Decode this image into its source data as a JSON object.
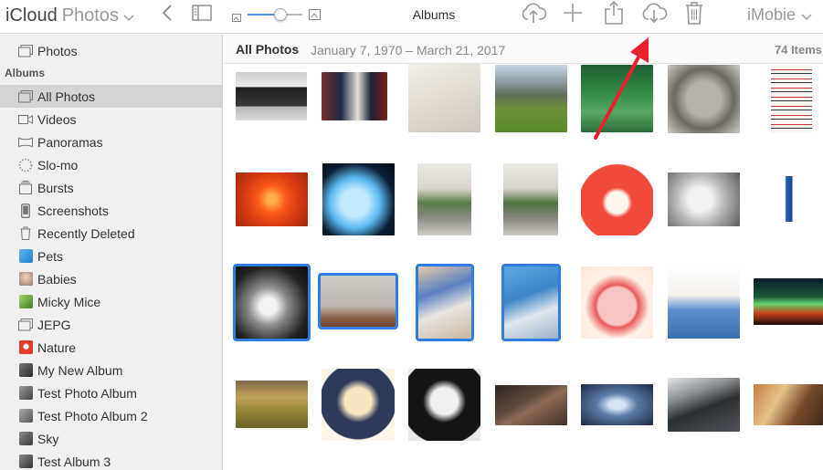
{
  "toolbar": {
    "app_name": "iCloud",
    "section_name": "Photos",
    "center_title": "Albums",
    "account": "iMobie",
    "icons": [
      "chevron-down",
      "back-chevron",
      "sidebar-toggle",
      "zoom-slider",
      "cloud-upload",
      "plus",
      "share",
      "cloud-download",
      "trash"
    ],
    "zoom_level": 0.6
  },
  "sidebar": {
    "top_item": {
      "label": "Photos",
      "icon": "photos-icon"
    },
    "albums_header": "Albums",
    "items": [
      {
        "label": "All Photos",
        "icon": "album-icon",
        "selected": true
      },
      {
        "label": "Videos",
        "icon": "video-icon"
      },
      {
        "label": "Panoramas",
        "icon": "panorama-icon"
      },
      {
        "label": "Slo-mo",
        "icon": "slomo-icon"
      },
      {
        "label": "Bursts",
        "icon": "bursts-icon"
      },
      {
        "label": "Screenshots",
        "icon": "screenshot-icon"
      },
      {
        "label": "Recently Deleted",
        "icon": "trash-icon"
      },
      {
        "label": "Pets",
        "icon": "pets-thumb"
      },
      {
        "label": "Babies",
        "icon": "babies-thumb"
      },
      {
        "label": "Micky Mice",
        "icon": "micky-thumb"
      },
      {
        "label": "JEPG",
        "icon": "album-icon"
      },
      {
        "label": "Nature",
        "icon": "nature-thumb"
      },
      {
        "label": "My New Album",
        "icon": "album-thumb"
      },
      {
        "label": "Test Photo Album",
        "icon": "album-thumb"
      },
      {
        "label": "Test Photo Album 2",
        "icon": "album-thumb"
      },
      {
        "label": "Sky",
        "icon": "album-thumb"
      },
      {
        "label": "Test Album 3",
        "icon": "album-thumb"
      }
    ]
  },
  "content": {
    "album_title": "All Photos",
    "date_range": "January 7, 1970 – March 21, 2017",
    "item_count": "74 Items",
    "photos": [
      {
        "name": "imac-desk",
        "selected": false
      },
      {
        "name": "press-podium",
        "selected": false
      },
      {
        "name": "desk-items",
        "selected": false
      },
      {
        "name": "mountain-meadow",
        "selected": false
      },
      {
        "name": "green-lake",
        "selected": false
      },
      {
        "name": "statue",
        "selected": false
      },
      {
        "name": "chart-poster",
        "selected": false
      },
      {
        "name": "red-flower",
        "selected": false
      },
      {
        "name": "whale-lamp",
        "selected": false
      },
      {
        "name": "office-plant-1",
        "selected": false
      },
      {
        "name": "office-plant-2",
        "selected": false
      },
      {
        "name": "red-fox-cartoon",
        "selected": false
      },
      {
        "name": "baby-bw",
        "selected": false
      },
      {
        "name": "person-standing",
        "selected": false
      },
      {
        "name": "dancer-dark",
        "selected": true
      },
      {
        "name": "foggy-tree",
        "selected": true
      },
      {
        "name": "boy-desk",
        "selected": true
      },
      {
        "name": "blue-desk",
        "selected": true
      },
      {
        "name": "pig-cartoon",
        "selected": false
      },
      {
        "name": "girl-headphones",
        "selected": false
      },
      {
        "name": "aurora",
        "selected": false
      },
      {
        "name": "lone-tree",
        "selected": false
      },
      {
        "name": "hooded-anime",
        "selected": false
      },
      {
        "name": "anime-girl-bw",
        "selected": false
      },
      {
        "name": "sticks-dark",
        "selected": false
      },
      {
        "name": "blue-texture",
        "selected": false
      },
      {
        "name": "keyboard-cable",
        "selected": false
      },
      {
        "name": "cartoon-scene",
        "selected": false
      }
    ]
  },
  "colors": {
    "selection": "#2f7de1",
    "annotation_arrow": "#e8222a",
    "sidebar_bg": "#f0f0f0",
    "sidebar_selected": "#d4d4d4"
  }
}
